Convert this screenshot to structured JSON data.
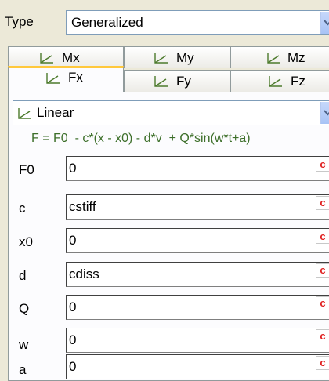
{
  "type_row": {
    "label": "Type",
    "value": "Generalized"
  },
  "tabs_top": [
    {
      "label": "Mx"
    },
    {
      "label": "My"
    },
    {
      "label": "Mz"
    }
  ],
  "tabs_bottom": [
    {
      "label": "Fx"
    },
    {
      "label": "Fy"
    },
    {
      "label": "Fz"
    }
  ],
  "active_tab": "Fx",
  "law": {
    "value": "Linear"
  },
  "formula": "F = F0  - c*(x - x0) - d*v  + Q*sin(w*t+a)",
  "params": [
    {
      "label": "F0",
      "value": "0"
    },
    {
      "label": "c",
      "value": "cstiff"
    },
    {
      "label": "x0",
      "value": "0"
    },
    {
      "label": "d",
      "value": "cdiss"
    },
    {
      "label": "Q",
      "value": "0"
    },
    {
      "label": "w",
      "value": "0"
    },
    {
      "label": "a",
      "value": "0"
    }
  ],
  "param_button_label": "c",
  "icons": {
    "axis": "xy-axis-icon",
    "dropdown": "chevron-down-icon"
  }
}
